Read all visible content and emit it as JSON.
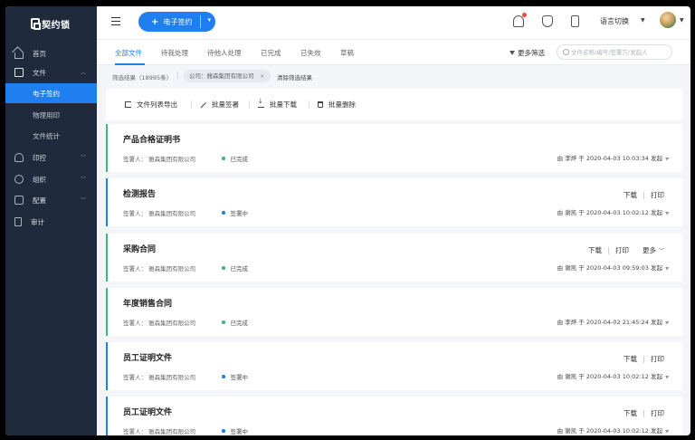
{
  "brand": {
    "name": "契约锁"
  },
  "sidebar": {
    "items": [
      {
        "label": "首页",
        "icon": "home-icon"
      },
      {
        "label": "文件",
        "icon": "document-icon",
        "expanded": true
      },
      {
        "label": "电子签约",
        "active": true
      },
      {
        "label": "物理用印"
      },
      {
        "label": "文件统计"
      },
      {
        "label": "印控",
        "icon": "stamp-icon"
      },
      {
        "label": "组织",
        "icon": "org-icon"
      },
      {
        "label": "配置",
        "icon": "settings-icon"
      },
      {
        "label": "审计",
        "icon": "audit-icon"
      }
    ]
  },
  "header": {
    "esign_label": "电子签约",
    "language_label": "语言切换"
  },
  "tabs": [
    "全部文件",
    "待我处理",
    "待他人处理",
    "已完成",
    "已失效",
    "草稿"
  ],
  "filter": {
    "more_filter": "更多筛选",
    "search_placeholder": "文件名称/编号/签署方/发起人",
    "result_count": "筛选结果（18995条）",
    "company_tag": "公司：雅森集团有限公司",
    "clear_label": "清除筛选结果"
  },
  "toolbar": {
    "export": "文件列表导出",
    "batch_sign": "批量签署",
    "batch_download": "批量下载",
    "batch_delete": "批量删除"
  },
  "documents": [
    {
      "title": "产品合格证明书",
      "signer": "签署人：  雅森集团有限公司",
      "status": "已完成",
      "meta": "由 李烨 于 2020-04-03 10:03:34 发起",
      "actions": []
    },
    {
      "title": "检测报告",
      "signer": "签署人：  雅森集团有限公司",
      "status": "签署中",
      "meta": "由 谢凯 于 2020-04-03 10:02:12 发起",
      "actions": [
        "下载",
        "打印"
      ]
    },
    {
      "title": "采购合同",
      "signer": "签署人：  雅森集团有限公司",
      "status": "已完成",
      "meta": "由 谢凯 于 2020-04-03 09:59:03 发起",
      "actions": [
        "下载",
        "打印",
        "更多"
      ]
    },
    {
      "title": "年度销售合同",
      "signer": "签署人：  雅森集团有限公司",
      "status": "已完成",
      "meta": "由 李烨 于 2020-04-02 21:45:24 发起",
      "actions": []
    },
    {
      "title": "员工证明文件",
      "signer": "签署人：  雅森集团有限公司",
      "status": "签署中",
      "meta": "由 谢凯 于 2020-04-03 10:02:12 发起",
      "actions": [
        "下载",
        "打印"
      ]
    },
    {
      "title": "员工证明文件",
      "signer": "签署人：  雅森集团有限公司",
      "status": "签署中",
      "meta": "由 谢凯 于 2020-04-03 10:02:12 发起",
      "actions": [
        "下载",
        "打印"
      ]
    }
  ],
  "colors": {
    "primary": "#1f7ff0",
    "sidebar_bg": "#1f2a3c",
    "done": "#3cb878",
    "in_progress": "#1f7ff0"
  }
}
